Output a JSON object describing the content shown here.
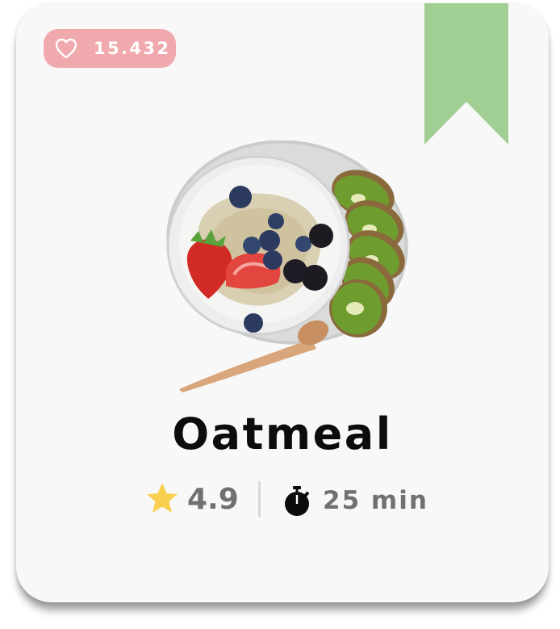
{
  "card": {
    "likes_count": "15.432",
    "heart_icon": "heart-outline-icon",
    "bookmark_icon": "bookmark-ribbon-icon",
    "image_icon": "oatmeal-bowl-image",
    "title": "Oatmeal",
    "rating": "4.9",
    "rating_icon": "star-icon",
    "time_icon": "stopwatch-icon",
    "duration": "25 min"
  },
  "colors": {
    "likes_badge": "#f0a9ad",
    "bookmark": "#a1cf93",
    "star": "#f9cf4f",
    "card_background": "#f8f8f8",
    "meta_text": "#707070"
  }
}
